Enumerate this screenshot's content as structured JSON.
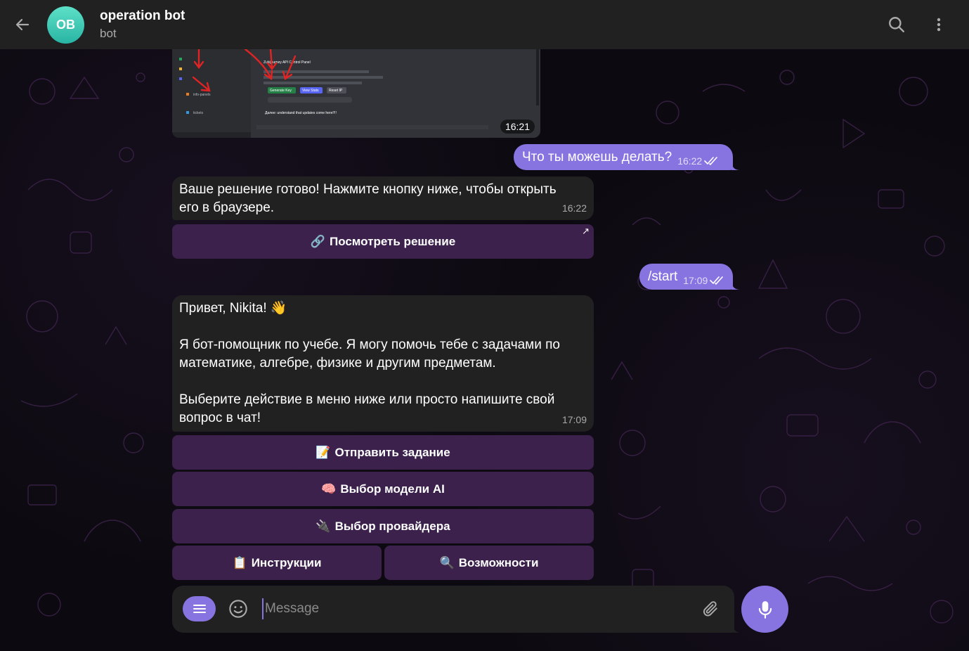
{
  "header": {
    "avatar_initials": "OB",
    "title": "operation bot",
    "subtitle": "bot",
    "icons": [
      "back-arrow-icon",
      "search-icon",
      "more-vertical-icon"
    ]
  },
  "messages": {
    "image_message": {
      "time": "16:21",
      "screenshot_lines": {
        "panel_title": "Zukijourney API Control Panel",
        "generate_key": "Generate Key",
        "view_stats": "View Stats",
        "reset_ip": "Reset IP",
        "info_panels": "info-panels",
        "tickets": "tickets",
        "announcement": "Далее: understand that updates come here!!!!"
      }
    },
    "out_1": {
      "text": "Что ты можешь делать?",
      "time": "16:22"
    },
    "in_1": {
      "lines": [
        "Ваше решение готово! Нажмите кнопку ниже, чтобы открыть",
        "его в браузере."
      ],
      "time": "16:22",
      "button": {
        "emoji": "🔗",
        "label": "Посмотреть решение",
        "corner": "↗"
      }
    },
    "out_2": {
      "text": "/start",
      "time": "17:09"
    },
    "in_2": {
      "lines": [
        "Привет, Nikita! 👋",
        "",
        "Я бот-помощник по учебе. Я могу помочь тебе с задачами по",
        "математике, алгебре, физике и другим предметам.",
        "",
        "Выберите действие в меню ниже или просто напишите свой",
        "вопрос в чат!"
      ],
      "time": "17:09",
      "buttons": {
        "send_task": {
          "emoji": "📝",
          "label": "Отправить задание"
        },
        "choose_model": {
          "emoji": "🧠",
          "label": "Выбор модели AI"
        },
        "choose_provider": {
          "emoji": "🔌",
          "label": "Выбор провайдера"
        },
        "instructions": {
          "emoji": "📋",
          "label": "Инструкции"
        },
        "features": {
          "emoji": "🔍",
          "label": "Возможности"
        }
      }
    }
  },
  "composer": {
    "placeholder": "Message",
    "icons": [
      "menu-icon",
      "emoji-icon",
      "attach-icon",
      "microphone-icon"
    ]
  },
  "colors": {
    "accent": "#8774e1",
    "header_bg": "#212121",
    "bubble_in": "#212121",
    "keyboard_button": "#422454",
    "avatar": "#3cc8b4"
  }
}
